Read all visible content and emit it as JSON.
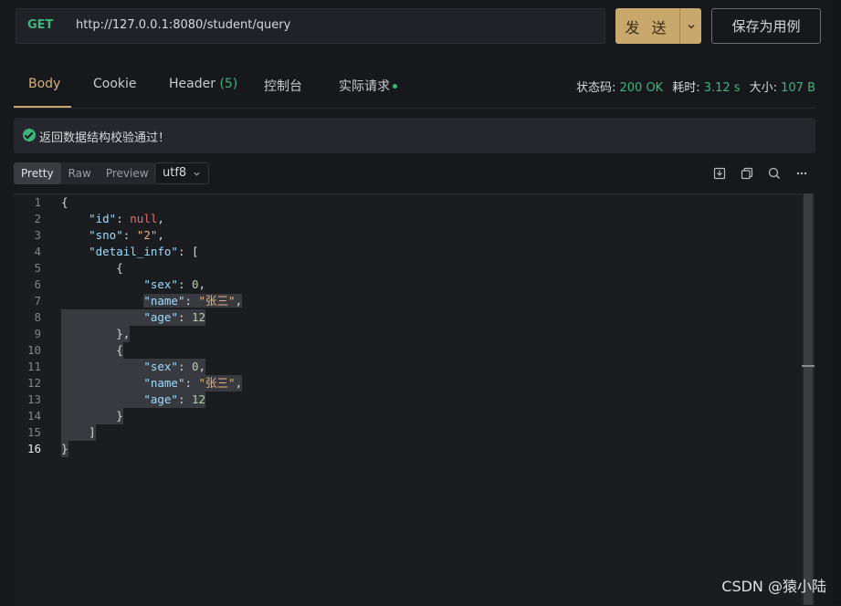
{
  "request": {
    "method": "GET",
    "url": "http://127.0.0.1:8080/student/query",
    "send_label": "发 送",
    "save_label": "保存为用例"
  },
  "tabs": [
    {
      "label": "Body"
    },
    {
      "label": "Cookie"
    },
    {
      "label": "Header",
      "count": "(5)"
    },
    {
      "label": "控制台"
    },
    {
      "label": "实际请求"
    }
  ],
  "stats": {
    "status_label": "状态码:",
    "status_value": "200 OK",
    "time_label": "耗时:",
    "time_value": "3.12 s",
    "size_label": "大小:",
    "size_value": "107 B"
  },
  "banner": {
    "text": "返回数据结构校验通过！"
  },
  "view": {
    "modes": [
      "Pretty",
      "Raw",
      "Preview"
    ],
    "active": "Pretty",
    "encoding": "utf8"
  },
  "toolbar_icons": [
    "download-icon",
    "copy-icon",
    "search-icon",
    "more-icon"
  ],
  "code": {
    "line_numbers": [
      "1",
      "2",
      "3",
      "4",
      "5",
      "6",
      "7",
      "8",
      "9",
      "10",
      "11",
      "12",
      "13",
      "14",
      "15",
      "16"
    ],
    "keys": {
      "id": "\"id\"",
      "sno": "\"sno\"",
      "detail_info": "\"detail_info\"",
      "sex": "\"sex\"",
      "name": "\"name\"",
      "age": "\"age\""
    },
    "values": {
      "null": "null",
      "sno": "\"2\"",
      "sex": "0",
      "name": "\"张三\"",
      "age": "12"
    }
  },
  "watermark": "CSDN @猿小陆"
}
